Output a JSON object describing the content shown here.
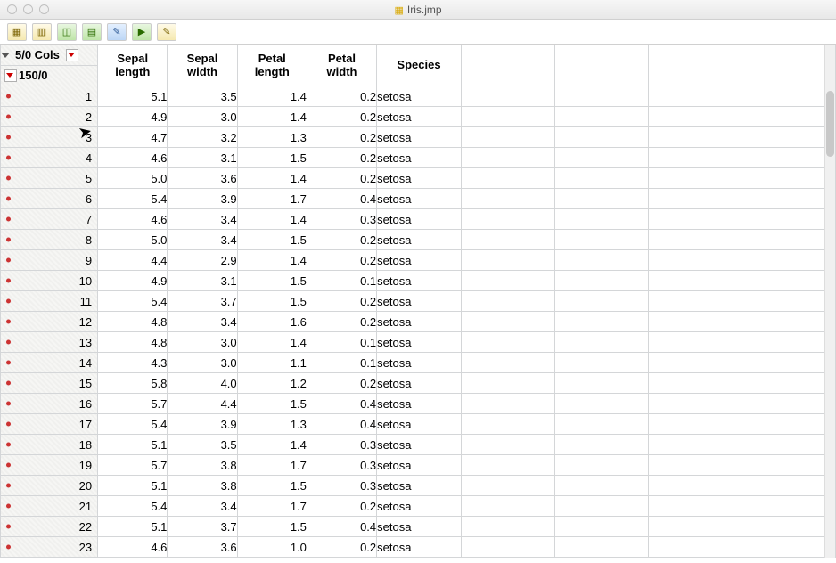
{
  "window": {
    "title": "Iris.jmp"
  },
  "panel": {
    "cols": "5/0 Cols",
    "rows": "150/0"
  },
  "columns": [
    "Sepal length",
    "Sepal width",
    "Petal length",
    "Petal width",
    "Species"
  ],
  "rows": [
    {
      "n": 1,
      "sl": "5.1",
      "sw": "3.5",
      "pl": "1.4",
      "pw": "0.2",
      "sp": "setosa"
    },
    {
      "n": 2,
      "sl": "4.9",
      "sw": "3.0",
      "pl": "1.4",
      "pw": "0.2",
      "sp": "setosa"
    },
    {
      "n": 3,
      "sl": "4.7",
      "sw": "3.2",
      "pl": "1.3",
      "pw": "0.2",
      "sp": "setosa"
    },
    {
      "n": 4,
      "sl": "4.6",
      "sw": "3.1",
      "pl": "1.5",
      "pw": "0.2",
      "sp": "setosa"
    },
    {
      "n": 5,
      "sl": "5.0",
      "sw": "3.6",
      "pl": "1.4",
      "pw": "0.2",
      "sp": "setosa"
    },
    {
      "n": 6,
      "sl": "5.4",
      "sw": "3.9",
      "pl": "1.7",
      "pw": "0.4",
      "sp": "setosa"
    },
    {
      "n": 7,
      "sl": "4.6",
      "sw": "3.4",
      "pl": "1.4",
      "pw": "0.3",
      "sp": "setosa"
    },
    {
      "n": 8,
      "sl": "5.0",
      "sw": "3.4",
      "pl": "1.5",
      "pw": "0.2",
      "sp": "setosa"
    },
    {
      "n": 9,
      "sl": "4.4",
      "sw": "2.9",
      "pl": "1.4",
      "pw": "0.2",
      "sp": "setosa"
    },
    {
      "n": 10,
      "sl": "4.9",
      "sw": "3.1",
      "pl": "1.5",
      "pw": "0.1",
      "sp": "setosa"
    },
    {
      "n": 11,
      "sl": "5.4",
      "sw": "3.7",
      "pl": "1.5",
      "pw": "0.2",
      "sp": "setosa"
    },
    {
      "n": 12,
      "sl": "4.8",
      "sw": "3.4",
      "pl": "1.6",
      "pw": "0.2",
      "sp": "setosa"
    },
    {
      "n": 13,
      "sl": "4.8",
      "sw": "3.0",
      "pl": "1.4",
      "pw": "0.1",
      "sp": "setosa"
    },
    {
      "n": 14,
      "sl": "4.3",
      "sw": "3.0",
      "pl": "1.1",
      "pw": "0.1",
      "sp": "setosa"
    },
    {
      "n": 15,
      "sl": "5.8",
      "sw": "4.0",
      "pl": "1.2",
      "pw": "0.2",
      "sp": "setosa"
    },
    {
      "n": 16,
      "sl": "5.7",
      "sw": "4.4",
      "pl": "1.5",
      "pw": "0.4",
      "sp": "setosa"
    },
    {
      "n": 17,
      "sl": "5.4",
      "sw": "3.9",
      "pl": "1.3",
      "pw": "0.4",
      "sp": "setosa"
    },
    {
      "n": 18,
      "sl": "5.1",
      "sw": "3.5",
      "pl": "1.4",
      "pw": "0.3",
      "sp": "setosa"
    },
    {
      "n": 19,
      "sl": "5.7",
      "sw": "3.8",
      "pl": "1.7",
      "pw": "0.3",
      "sp": "setosa"
    },
    {
      "n": 20,
      "sl": "5.1",
      "sw": "3.8",
      "pl": "1.5",
      "pw": "0.3",
      "sp": "setosa"
    },
    {
      "n": 21,
      "sl": "5.4",
      "sw": "3.4",
      "pl": "1.7",
      "pw": "0.2",
      "sp": "setosa"
    },
    {
      "n": 22,
      "sl": "5.1",
      "sw": "3.7",
      "pl": "1.5",
      "pw": "0.4",
      "sp": "setosa"
    },
    {
      "n": 23,
      "sl": "4.6",
      "sw": "3.6",
      "pl": "1.0",
      "pw": "0.2",
      "sp": "setosa"
    }
  ]
}
